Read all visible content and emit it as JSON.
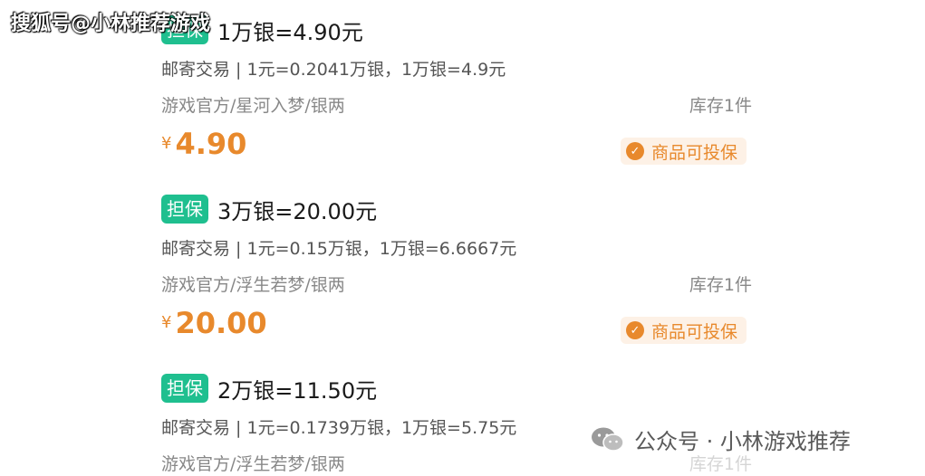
{
  "watermark_top": "搜狐号@小林推荐游戏",
  "watermark_bottom": "公众号 · 小林游戏推荐",
  "listings": [
    {
      "badge": "担保",
      "title": "1万银=4.90元",
      "desc": "邮寄交易 | 1元=0.2041万银，1万银=4.9元",
      "source": "游戏官方/星河入梦/银两",
      "stock": "库存1件",
      "currency": "¥",
      "price": "4.90",
      "guarantee": "商品可投保"
    },
    {
      "badge": "担保",
      "title": "3万银=20.00元",
      "desc": "邮寄交易 | 1元=0.15万银，1万银=6.6667元",
      "source": "游戏官方/浮生若梦/银两",
      "stock": "库存1件",
      "currency": "¥",
      "price": "20.00",
      "guarantee": "商品可投保"
    },
    {
      "badge": "担保",
      "title": "2万银=11.50元",
      "desc": "邮寄交易 | 1元=0.1739万银，1万银=5.75元",
      "source": "游戏官方/浮生若梦/银两",
      "stock": "库存1件"
    }
  ],
  "colors": {
    "badge_green": "#1fbf8f",
    "price_orange": "#e8892c"
  }
}
